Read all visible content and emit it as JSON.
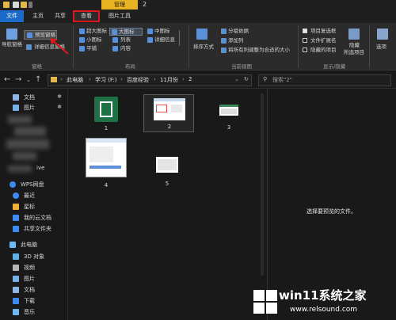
{
  "titlebar": {
    "manage_label": "管理",
    "folder_name": "2"
  },
  "tabs": {
    "file": "文件",
    "home": "主页",
    "share": "共享",
    "view": "查看",
    "picture_tools": "图片工具"
  },
  "ribbon": {
    "panes": {
      "nav_pane": "导航窗格",
      "preview_pane": "预览窗格",
      "details_pane": "详细信息窗格",
      "group_label": "窗格"
    },
    "layout": {
      "xl_icons": "超大图标",
      "large_icons": "大图标",
      "medium_icons": "中图标",
      "small_icons": "小图标",
      "list": "列表",
      "details": "详细信息",
      "tiles": "平铺",
      "content": "内容",
      "group_label": "布局"
    },
    "current_view": {
      "sort_by": "排序方式",
      "group_by": "分组依据",
      "add_columns": "添加列",
      "size_all_columns": "将所有列调整为合适的大小",
      "group_label": "当前视图"
    },
    "show_hide": {
      "item_checkboxes": "项目复选框",
      "file_extensions": "文件扩展名",
      "hidden_items": "隐藏的项目",
      "hide_selected": "隐藏",
      "hide_selected_2": "所选项目",
      "group_label": "显示/隐藏",
      "item_checkboxes_checked": true,
      "file_extensions_checked": false,
      "hidden_items_checked": false
    },
    "options": "选项"
  },
  "address": {
    "crumbs": [
      "此电脑",
      "学习 (F:)",
      "百度经验",
      "11月份",
      "2"
    ],
    "search_placeholder": "搜索\"2\""
  },
  "sidebar": {
    "items": [
      {
        "label": "文档",
        "icon": "document-icon",
        "pinned": true
      },
      {
        "label": "图片",
        "icon": "pictures-icon",
        "pinned": true
      },
      {
        "label": "ive",
        "icon": "onedrive-icon",
        "pinned": false
      },
      {
        "label": "WPS网盘",
        "icon": "wps-cloud-icon",
        "pinned": false
      },
      {
        "label": "最近",
        "icon": "recent-icon",
        "pinned": false
      },
      {
        "label": "星标",
        "icon": "star-icon",
        "pinned": false
      },
      {
        "label": "我的云文档",
        "icon": "cloud-docs-icon",
        "pinned": false
      },
      {
        "label": "共享文件夹",
        "icon": "shared-folder-icon",
        "pinned": false
      },
      {
        "label": "此电脑",
        "icon": "this-pc-icon",
        "pinned": false
      },
      {
        "label": "3D 对象",
        "icon": "3d-objects-icon",
        "pinned": false
      },
      {
        "label": "视频",
        "icon": "videos-icon",
        "pinned": false
      },
      {
        "label": "图片",
        "icon": "pictures-icon",
        "pinned": false
      },
      {
        "label": "文档",
        "icon": "documents-icon",
        "pinned": false
      },
      {
        "label": "下载",
        "icon": "downloads-icon",
        "pinned": false
      },
      {
        "label": "音乐",
        "icon": "music-icon",
        "pinned": false
      }
    ]
  },
  "files": [
    {
      "name": "1",
      "kind": "excel-icon",
      "selected": false
    },
    {
      "name": "2",
      "kind": "spreadsheet-thumbnail",
      "selected": true
    },
    {
      "name": "3",
      "kind": "spreadsheet-thumbnail",
      "selected": false
    },
    {
      "name": "4",
      "kind": "dialog-thumbnail",
      "selected": false
    },
    {
      "name": "5",
      "kind": "table-thumbnail",
      "selected": false
    }
  ],
  "preview": {
    "message": "选择要预览的文件。"
  },
  "watermark": {
    "title": "win11系统之家",
    "url": "www.relsound.com"
  },
  "colors": {
    "file_tab": "#1b6ac9",
    "manage_tab": "#e8b321",
    "highlight": "#e1161c",
    "background": "#191919"
  }
}
